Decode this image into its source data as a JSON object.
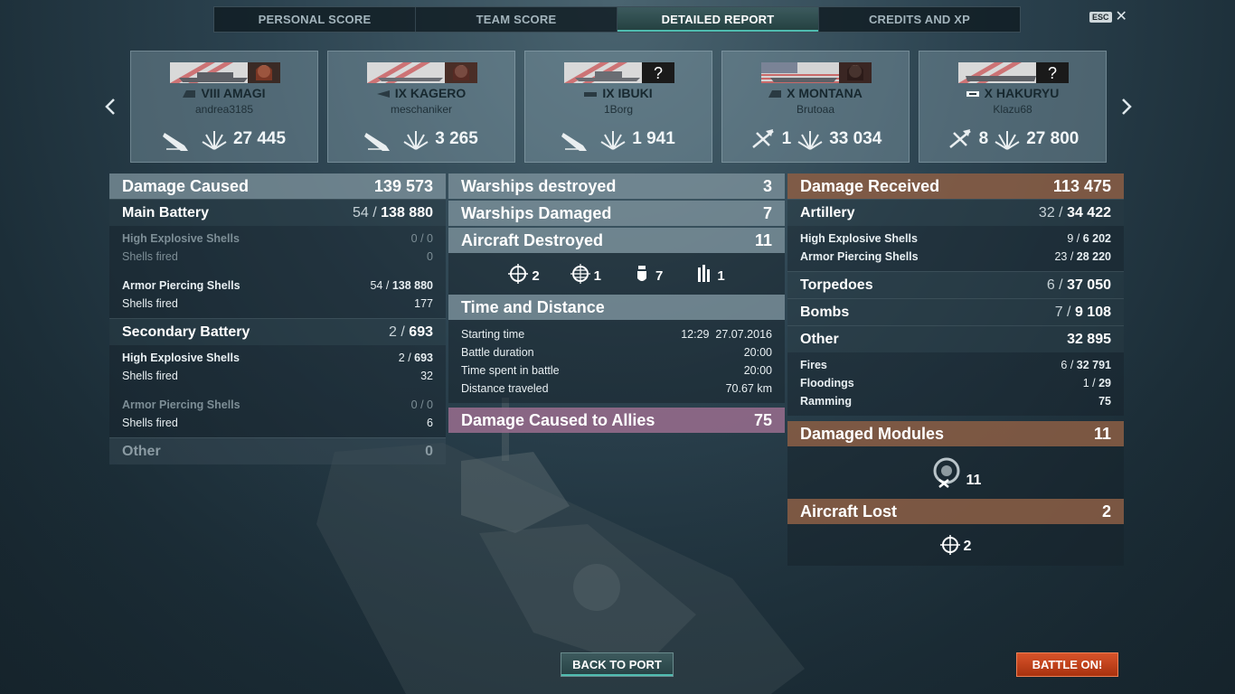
{
  "tabs": [
    {
      "label": "PERSONAL SCORE",
      "active": false
    },
    {
      "label": "TEAM SCORE",
      "active": false
    },
    {
      "label": "DETAILED REPORT",
      "active": true
    },
    {
      "label": "CREDITS AND XP",
      "active": false
    }
  ],
  "esc_label": "ESC",
  "cards": [
    {
      "tier": "VIII",
      "ship": "AMAGI",
      "player": "andrea3185",
      "kills": "",
      "damage": "27 445",
      "class_icon": "battleship-icon",
      "kill_icon": "sinking-ship-icon"
    },
    {
      "tier": "IX",
      "ship": "KAGERO",
      "player": "meschaniker",
      "kills": "",
      "damage": "3 265",
      "class_icon": "destroyer-icon",
      "kill_icon": "sinking-ship-icon"
    },
    {
      "tier": "IX",
      "ship": "IBUKI",
      "player": "1Borg",
      "kills": "",
      "damage": "1 941",
      "class_icon": "cruiser-icon",
      "kill_icon": "sinking-ship-icon"
    },
    {
      "tier": "X",
      "ship": "MONTANA",
      "player": "Brutoaa",
      "kills": "1",
      "damage": "33 034",
      "class_icon": "battleship-icon",
      "kill_icon": "plane-destroyed-icon"
    },
    {
      "tier": "X",
      "ship": "HAKURYU",
      "player": "Klazu68",
      "kills": "8",
      "damage": "27 800",
      "class_icon": "carrier-icon",
      "kill_icon": "plane-destroyed-icon"
    }
  ],
  "left": {
    "damage_caused": {
      "label": "Damage Caused",
      "value": "139 573"
    },
    "main_battery": {
      "label": "Main Battery",
      "hits": "54",
      "value": "138 880"
    },
    "mb_he": {
      "label": "High Explosive Shells",
      "value": "0 / 0"
    },
    "mb_he_fired": {
      "label": "Shells fired",
      "value": "0"
    },
    "mb_ap": {
      "label": "Armor Piercing Shells",
      "hits": "54",
      "value": "138 880"
    },
    "mb_ap_fired": {
      "label": "Shells fired",
      "value": "177"
    },
    "secondary": {
      "label": "Secondary Battery",
      "hits": "2",
      "value": "693"
    },
    "sb_he": {
      "label": "High Explosive Shells",
      "hits": "2",
      "value": "693"
    },
    "sb_he_fired": {
      "label": "Shells fired",
      "value": "32"
    },
    "sb_ap": {
      "label": "Armor Piercing Shells",
      "value": "0 / 0"
    },
    "sb_ap_fired": {
      "label": "Shells fired",
      "value": "6"
    },
    "other": {
      "label": "Other",
      "value": "0"
    }
  },
  "middle": {
    "warships_destroyed": {
      "label": "Warships destroyed",
      "value": "3"
    },
    "warships_damaged": {
      "label": "Warships Damaged",
      "value": "7"
    },
    "aircraft_destroyed": {
      "label": "Aircraft Destroyed",
      "value": "11"
    },
    "aircraft": [
      {
        "icon": "fighter-crosshair-icon",
        "count": "2"
      },
      {
        "icon": "spotter-crosshair-icon",
        "count": "1"
      },
      {
        "icon": "bomb-icon",
        "count": "7"
      },
      {
        "icon": "torpedo-icon",
        "count": "1"
      }
    ],
    "time_distance": {
      "label": "Time and Distance"
    },
    "starting_time": {
      "label": "Starting time",
      "value": "12:29  27.07.2016"
    },
    "battle_duration": {
      "label": "Battle duration",
      "value": "20:00"
    },
    "time_spent": {
      "label": "Time spent in battle",
      "value": "20:00"
    },
    "distance": {
      "label": "Distance traveled",
      "value": "70.67 km"
    },
    "allies": {
      "label": "Damage Caused to Allies",
      "value": "75"
    }
  },
  "right": {
    "damage_received": {
      "label": "Damage Received",
      "value": "113 475"
    },
    "artillery": {
      "label": "Artillery",
      "hits": "32",
      "value": "34 422"
    },
    "he": {
      "label": "High Explosive Shells",
      "hits": "9",
      "value": "6 202"
    },
    "ap": {
      "label": "Armor Piercing Shells",
      "hits": "23",
      "value": "28 220"
    },
    "torpedoes": {
      "label": "Torpedoes",
      "hits": "6",
      "value": "37 050"
    },
    "bombs": {
      "label": "Bombs",
      "hits": "7",
      "value": "9 108"
    },
    "other": {
      "label": "Other",
      "value": "32 895"
    },
    "fires": {
      "label": "Fires",
      "hits": "6",
      "value": "32 791"
    },
    "floodings": {
      "label": "Floodings",
      "hits": "1",
      "value": "29"
    },
    "ramming": {
      "label": "Ramming",
      "value": "75"
    },
    "damaged_modules": {
      "label": "Damaged Modules",
      "value": "11",
      "icon_count": "11"
    },
    "aircraft_lost": {
      "label": "Aircraft Lost",
      "value": "2",
      "icon_count": "2"
    }
  },
  "buttons": {
    "back": "BACK TO PORT",
    "battle": "BATTLE ON!"
  }
}
